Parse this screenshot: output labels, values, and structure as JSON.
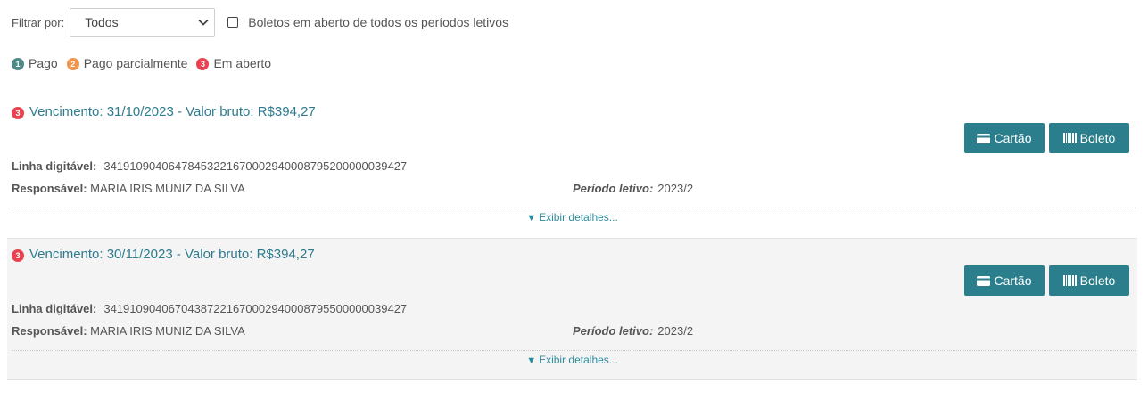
{
  "filter": {
    "label": "Filtrar por:",
    "selected": "Todos",
    "checkbox_label": "Boletos em aberto de todos os períodos letivos"
  },
  "legend": [
    {
      "number": "1",
      "label": "Pago",
      "color": "#4f8a87"
    },
    {
      "number": "2",
      "label": "Pago parcialmente",
      "color": "#f0944b"
    },
    {
      "number": "3",
      "label": "Em aberto",
      "color": "#e84250"
    }
  ],
  "labels": {
    "linha": "Linha digitável:",
    "responsavel": "Responsável:",
    "periodo": "Período letivo:",
    "cartao": "Cartão",
    "boleto": "Boleto",
    "details": "Exibir detalhes..."
  },
  "boletos": [
    {
      "status_number": "3",
      "title": "Vencimento: 31/10/2023 - Valor bruto: R$394,27",
      "linha": "34191090406478453221670002940008795200000039427",
      "responsavel": "MARIA IRIS MUNIZ DA SILVA",
      "periodo": "2023/2"
    },
    {
      "status_number": "3",
      "title": "Vencimento: 30/11/2023 - Valor bruto: R$394,27",
      "linha": "34191090406704387221670002940008795500000039427",
      "responsavel": "MARIA IRIS MUNIZ DA SILVA",
      "periodo": "2023/2"
    }
  ],
  "colors": {
    "accent": "#2b7f8c",
    "title": "#2d7b8e",
    "status_open": "#e84250"
  }
}
